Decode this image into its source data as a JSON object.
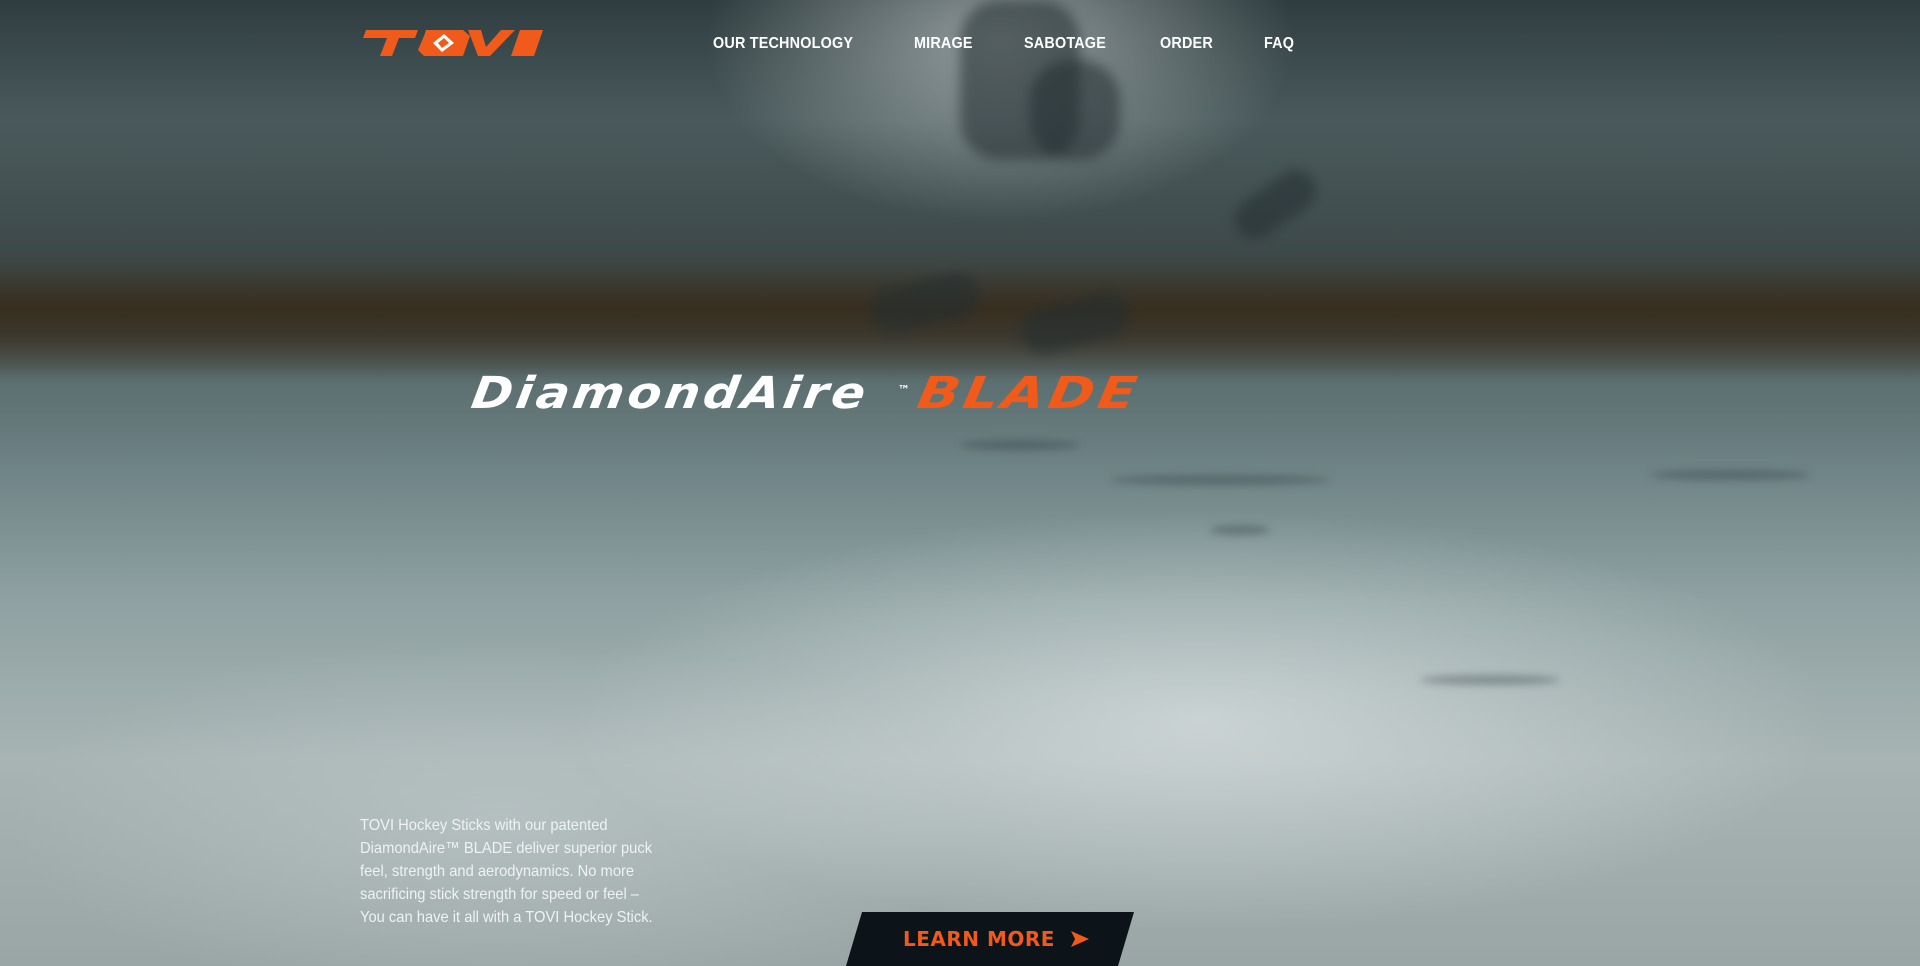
{
  "brand": {
    "logo_text": "TOVI",
    "accent_color": "#f05a1a"
  },
  "nav": {
    "items": [
      {
        "label": "OUR TECHNOLOGY"
      },
      {
        "label": "MIRAGE"
      },
      {
        "label": "SABOTAGE"
      },
      {
        "label": "ORDER"
      },
      {
        "label": "FAQ"
      }
    ]
  },
  "hero": {
    "headline_white": "DiamondAire",
    "headline_tm": "™",
    "headline_orange": "BLADE",
    "description": "TOVI Hockey Sticks with our patented DiamondAire™ BLADE deliver superior puck feel, strength and aerodynamics. No more sacrificing stick strength for speed or feel – You can have it all with a TOVI Hockey Stick.",
    "cta_label": "LEARN MORE",
    "cta_icon": "arrow-right-icon"
  }
}
